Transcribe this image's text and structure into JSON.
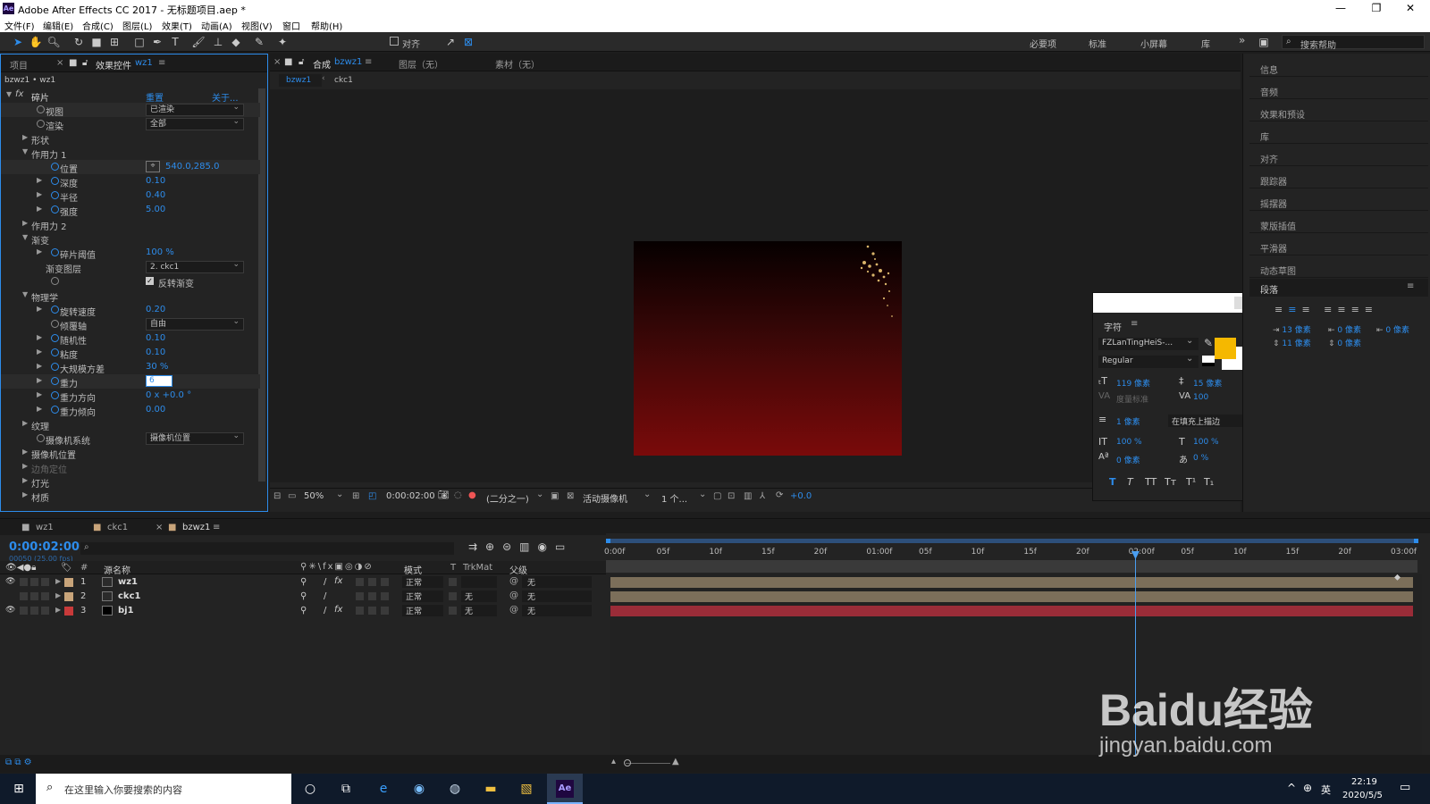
{
  "window": {
    "title": "Adobe After Effects CC 2017 - 无标题项目.aep *",
    "app_icon": "Ae",
    "min": "—",
    "max": "❐",
    "close": "✕"
  },
  "menu": [
    "文件(F)",
    "编辑(E)",
    "合成(C)",
    "图层(L)",
    "效果(T)",
    "动画(A)",
    "视图(V)",
    "窗口",
    "帮助(H)"
  ],
  "toolbar": {
    "snap_label": "对齐",
    "workspaces": [
      "必要项",
      "标准",
      "小屏幕",
      "库"
    ],
    "more": "»",
    "search_placeholder": "搜索帮助"
  },
  "effects_panel": {
    "tab_project": "项目",
    "tab_effects": "效果控件",
    "tab_layer": "wz1",
    "breadcrumb": "bzwz1 • wz1",
    "fx": "fx",
    "effect_name": "碎片",
    "reset": "重置",
    "about": "关于...",
    "rows": [
      {
        "label": "视图",
        "dropdown": "已渲染"
      },
      {
        "label": "渲染",
        "dropdown": "全部"
      },
      {
        "label": "形状"
      },
      {
        "label": "作用力 1"
      },
      {
        "label": "位置",
        "value": "540.0,285.0"
      },
      {
        "label": "深度",
        "value": "0.10"
      },
      {
        "label": "半径",
        "value": "0.40"
      },
      {
        "label": "强度",
        "value": "5.00"
      },
      {
        "label": "作用力 2"
      },
      {
        "label": "渐变"
      },
      {
        "label": "碎片阈值",
        "value": "100 %"
      },
      {
        "label": "渐变图层",
        "dropdown": "2. ckc1"
      },
      {
        "label": "反转渐变"
      },
      {
        "label": "物理学"
      },
      {
        "label": "旋转速度",
        "value": "0.20"
      },
      {
        "label": "倾覆轴",
        "dropdown": "自由"
      },
      {
        "label": "随机性",
        "value": "0.10"
      },
      {
        "label": "粘度",
        "value": "0.10"
      },
      {
        "label": "大规模方差",
        "value": "30 %"
      },
      {
        "label": "重力",
        "value": "6"
      },
      {
        "label": "重力方向",
        "value": "0 x +0.0 °"
      },
      {
        "label": "重力倾向",
        "value": "0.00"
      },
      {
        "label": "纹理"
      },
      {
        "label": "摄像机系统",
        "dropdown": "摄像机位置"
      },
      {
        "label": "摄像机位置"
      },
      {
        "label": "边角定位"
      },
      {
        "label": "灯光"
      },
      {
        "label": "材质"
      }
    ]
  },
  "comp_panel": {
    "tab_comp": "合成",
    "tab_comp_name": "bzwz1",
    "tab_layer": "图层（无）",
    "tab_footage": "素材（无）",
    "crumb1": "bzwz1",
    "crumb2": "ckc1",
    "zoom": "50%",
    "timecode": "0:00:02:00",
    "resolution": "(二分之一)",
    "camera": "活动摄像机",
    "views": "1 个...",
    "exposure": "+0.0"
  },
  "right_panels": [
    "信息",
    "音频",
    "效果和预设",
    "库",
    "对齐",
    "跟踪器",
    "摇摆器",
    "蒙版插值",
    "平滑器",
    "动态草图"
  ],
  "paragraph": {
    "title": "段落",
    "indent1": "13 像素",
    "indent2": "0 像素",
    "indent3": "0 像素",
    "space1": "11 像素",
    "space2": "0 像素"
  },
  "character": {
    "title": "字符",
    "font": "FZLanTingHeiS-...",
    "style": "Regular",
    "size": "119 像素",
    "leading": "15 像素",
    "kerning": "度量标准",
    "tracking": "100",
    "stroke": "1 像素",
    "stroke_mode": "在填充上描边",
    "vscale": "100 %",
    "hscale": "100 %",
    "baseline": "0 像素",
    "tsume": "0 %",
    "fill_color": "#f5b800",
    "styles": [
      "T",
      "T",
      "TT",
      "Tт",
      "T¹",
      "T₁"
    ]
  },
  "timeline": {
    "tabs": [
      "wz1",
      "ckc1",
      "bzwz1"
    ],
    "timecode": "0:00:02:00",
    "fps": "00050 (25.00 fps)",
    "search_placeholder": "",
    "col_num": "#",
    "col_name": "源名称",
    "col_mode": "模式",
    "col_t": "T",
    "col_trkmat": "TrkMat",
    "col_parent": "父级",
    "ruler": [
      "0:00f",
      "05f",
      "10f",
      "15f",
      "20f",
      "01:00f",
      "05f",
      "10f",
      "15f",
      "20f",
      "02:00f",
      "05f",
      "10f",
      "15f",
      "20f",
      "03:00f"
    ],
    "layers": [
      {
        "num": "1",
        "name": "wz1",
        "mode": "正常",
        "trkmat": "",
        "parent": "无",
        "color": "#c8a47a",
        "bar": "#7c6f5a"
      },
      {
        "num": "2",
        "name": "ckc1",
        "mode": "正常",
        "trkmat": "无",
        "parent": "无",
        "color": "#c8a47a",
        "bar": "#7c6f5a"
      },
      {
        "num": "3",
        "name": "bj1",
        "mode": "正常",
        "trkmat": "无",
        "parent": "无",
        "color": "#c83a3a",
        "bar": "#9a2c38"
      }
    ],
    "playhead_fraction": 0.667
  },
  "taskbar": {
    "search_text": "在这里输入你要搜索的内容",
    "time": "22:19",
    "date": "2020/5/5",
    "lang": "英"
  },
  "watermark": {
    "brand": "Baidu经验",
    "url": "jingyan.baidu.com"
  }
}
